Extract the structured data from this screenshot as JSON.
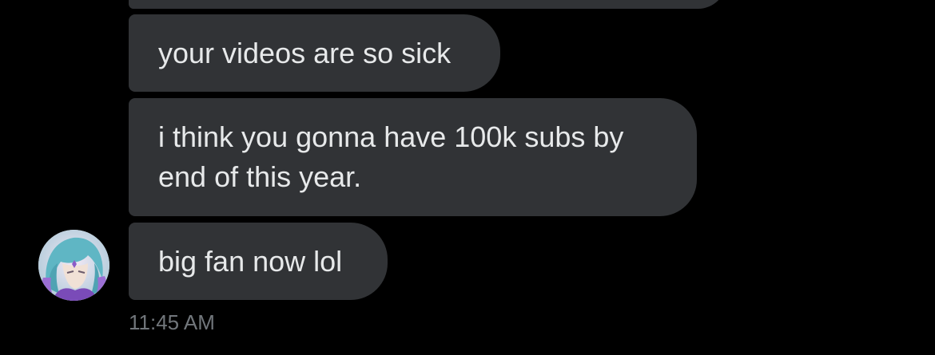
{
  "messages": [
    {
      "text": ""
    },
    {
      "text": "your videos are so sick"
    },
    {
      "text": "i think you gonna have 100k subs by end of this year."
    },
    {
      "text": "big fan now lol"
    }
  ],
  "timestamp": "11:45 AM",
  "colors": {
    "background": "#000000",
    "bubble": "#313336",
    "text": "#e7e9ea",
    "timestamp": "#71767b"
  },
  "sender": {
    "avatar_icon": "avatar-icon"
  }
}
